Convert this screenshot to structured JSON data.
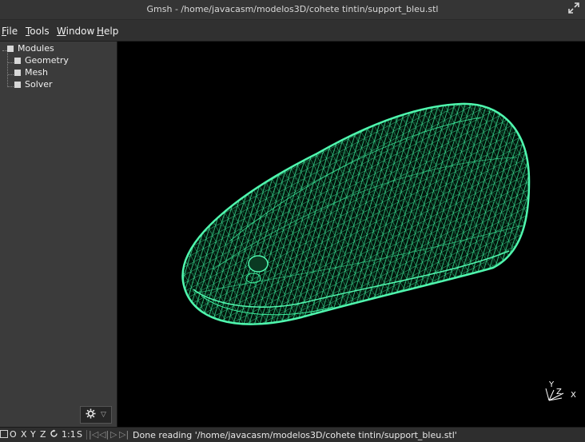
{
  "window": {
    "title": "Gmsh - /home/javacasm/modelos3D/cohete tintin/support_bleu.stl",
    "maximize_icon": "maximize-icon"
  },
  "menu": {
    "file": {
      "ul": "F",
      "rest": "ile"
    },
    "tools": {
      "ul": "T",
      "rest": "ools"
    },
    "window": {
      "ul": "W",
      "rest": "indow"
    },
    "help": {
      "ul": "H",
      "rest": "elp"
    }
  },
  "tree": {
    "root": "Modules",
    "children": [
      "Geometry",
      "Mesh",
      "Solver"
    ]
  },
  "status": {
    "buttons": [
      "O",
      "X",
      "Y",
      "Z",
      "1:1",
      "S"
    ],
    "message": "Done reading '/home/javacasm/modelos3D/cohete tintin/support_bleu.stl'"
  },
  "axes": {
    "x": "X",
    "y": "Y",
    "z": "Z"
  },
  "colors": {
    "mesh": "#3df2a0",
    "viewport_bg": "#000000",
    "panel_bg": "#3b3b3b"
  }
}
